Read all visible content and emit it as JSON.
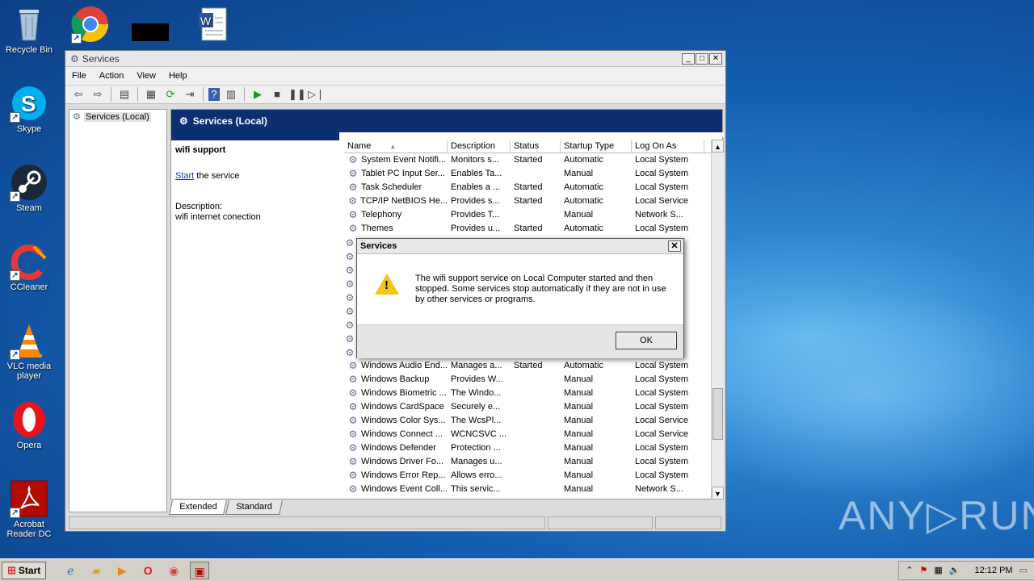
{
  "desktop": {
    "icons": [
      {
        "label": "Recycle Bin",
        "glyph": "🗑"
      },
      {
        "label": "",
        "glyph": "chrome"
      },
      {
        "label": "",
        "glyph": "black-rect"
      },
      {
        "label": "",
        "glyph": "W"
      },
      {
        "label": "Skype",
        "glyph": "S"
      },
      {
        "label": "Steam",
        "glyph": "steam"
      },
      {
        "label": "CCleaner",
        "glyph": "C"
      },
      {
        "label": "VLC media player",
        "glyph": "vlc"
      },
      {
        "label": "Opera",
        "glyph": "O"
      },
      {
        "label": "Acrobat Reader DC",
        "glyph": "pdf"
      }
    ],
    "watermark": "ANY▷RUN"
  },
  "window": {
    "title": "Services",
    "menu": [
      "File",
      "Action",
      "View",
      "Help"
    ],
    "tree_item": "Services (Local)",
    "header": "Services (Local)",
    "selected_service": "wifi support",
    "start_link": "Start",
    "start_rest": " the service",
    "description_label": "Description:",
    "description_text": "wifi internet conection",
    "columns": [
      "Name",
      "Description",
      "Status",
      "Startup Type",
      "Log On As"
    ],
    "rows": [
      [
        "System Event Notifi...",
        "Monitors s...",
        "Started",
        "Automatic",
        "Local System"
      ],
      [
        "Tablet PC Input Ser...",
        "Enables Ta...",
        "",
        "Manual",
        "Local System"
      ],
      [
        "Task Scheduler",
        "Enables a ...",
        "Started",
        "Automatic",
        "Local System"
      ],
      [
        "TCP/IP NetBIOS He...",
        "Provides s...",
        "Started",
        "Automatic",
        "Local Service"
      ],
      [
        "Telephony",
        "Provides T...",
        "",
        "Manual",
        "Network S..."
      ],
      [
        "Themes",
        "Provides u...",
        "Started",
        "Automatic",
        "Local System"
      ]
    ],
    "rows_bottom": [
      [
        "Windows Audio End...",
        "Manages a...",
        "Started",
        "Automatic",
        "Local System"
      ],
      [
        "Windows Backup",
        "Provides W...",
        "",
        "Manual",
        "Local System"
      ],
      [
        "Windows Biometric ...",
        "The Windo...",
        "",
        "Manual",
        "Local System"
      ],
      [
        "Windows CardSpace",
        "Securely e...",
        "",
        "Manual",
        "Local System"
      ],
      [
        "Windows Color Sys...",
        "The WcsPl...",
        "",
        "Manual",
        "Local Service"
      ],
      [
        "Windows Connect ...",
        "WCNCSVC ...",
        "",
        "Manual",
        "Local Service"
      ],
      [
        "Windows Defender",
        "Protection ...",
        "",
        "Manual",
        "Local System"
      ],
      [
        "Windows Driver Fo...",
        "Manages u...",
        "",
        "Manual",
        "Local System"
      ],
      [
        "Windows Error Rep...",
        "Allows erro...",
        "",
        "Manual",
        "Local System"
      ],
      [
        "Windows Event Coll...",
        "This servic...",
        "",
        "Manual",
        "Network S..."
      ]
    ],
    "tabs": [
      "Extended",
      "Standard"
    ]
  },
  "dialog": {
    "title": "Services",
    "message": "The wifi support service on Local Computer started and then stopped. Some services stop automatically if they are not in use by other services or programs.",
    "ok": "OK"
  },
  "taskbar": {
    "start": "Start",
    "clock": "12:12 PM"
  }
}
